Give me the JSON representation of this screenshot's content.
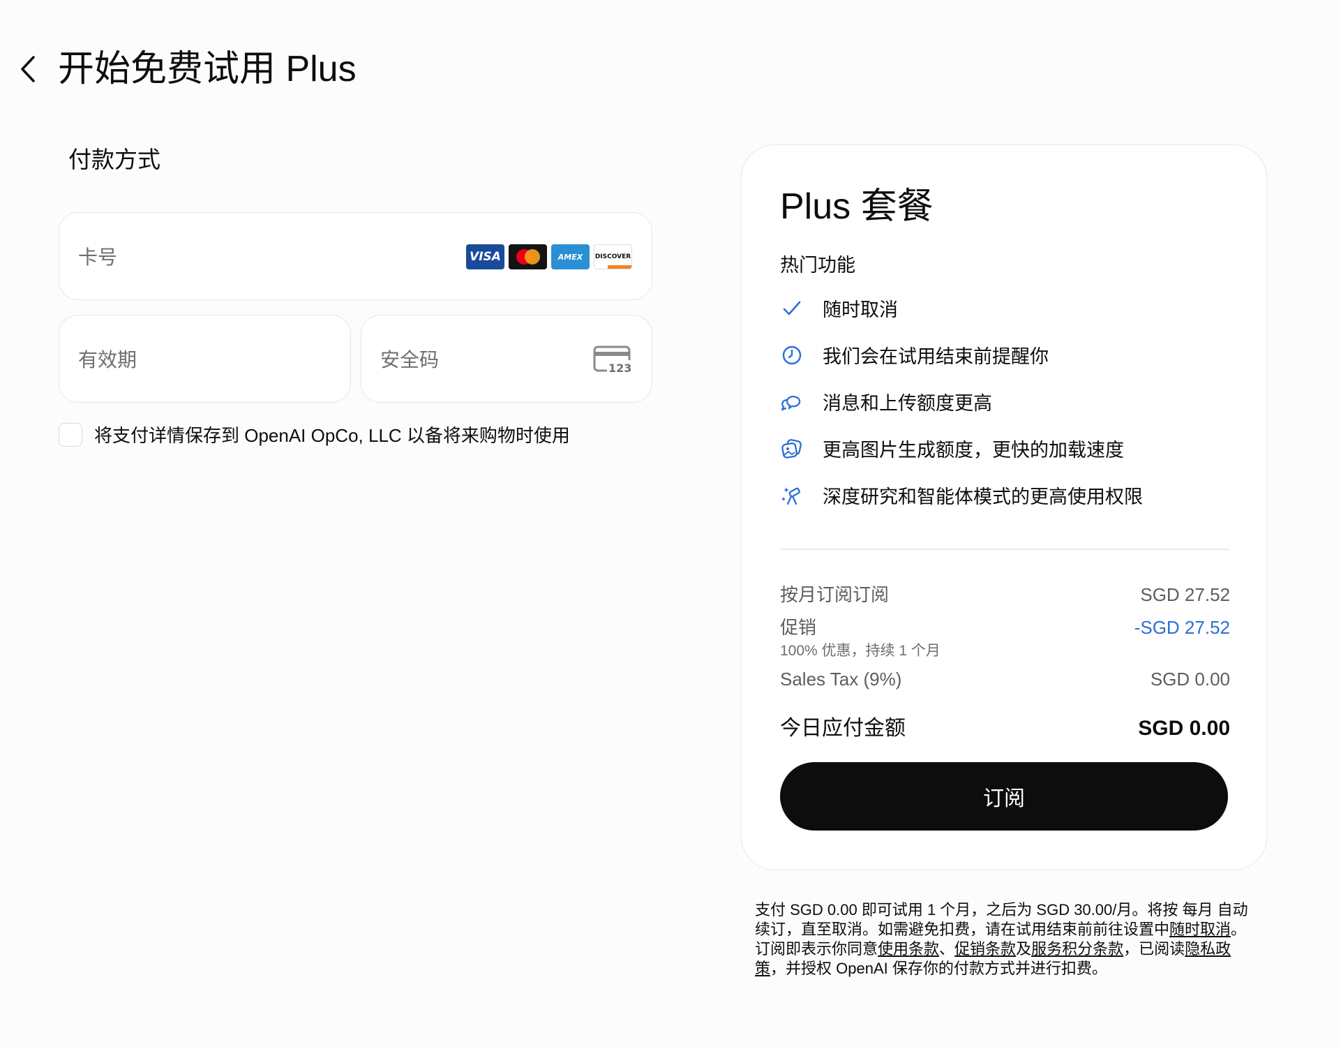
{
  "header": {
    "title": "开始免费试用 Plus"
  },
  "payment": {
    "section_title": "付款方式",
    "card_number_placeholder": "卡号",
    "card_brands": [
      "VISA",
      "Mastercard",
      "AMEX",
      "DISCOVER"
    ],
    "expiry_placeholder": "有效期",
    "cvc_placeholder": "安全码",
    "cvc_icon_text": "123",
    "save_details_label": "将支付详情保存到 OpenAI OpCo, LLC 以备将来购物时使用"
  },
  "plan": {
    "title": "Plus 套餐",
    "features_title": "热门功能",
    "features": [
      {
        "icon": "check-icon",
        "label": "随时取消"
      },
      {
        "icon": "clock-icon",
        "label": "我们会在试用结束前提醒你"
      },
      {
        "icon": "chat-bubbles-icon",
        "label": "消息和上传额度更高"
      },
      {
        "icon": "image-gallery-icon",
        "label": "更高图片生成额度，更快的加载速度"
      },
      {
        "icon": "telescope-icon",
        "label": "深度研究和智能体模式的更高使用权限"
      }
    ],
    "pricing": {
      "monthly_label": "按月订阅订阅",
      "monthly_value": "SGD 27.52",
      "promo_label": "促销",
      "promo_value": "-SGD 27.52",
      "promo_detail": "100% 优惠，持续 1 个月",
      "tax_label": "Sales Tax (9%)",
      "tax_value": "SGD 0.00",
      "total_label": "今日应付金额",
      "total_value": "SGD 0.00"
    },
    "subscribe_label": "订阅"
  },
  "legal": {
    "part1": "支付 SGD 0.00 即可试用 1 个月，之后为 SGD 30.00/月。将按 每月 自动续订，直至取消。如需避免扣费，请在试用结束前前往设置中",
    "cancel_link": "随时取消",
    "part2": "。订阅即表示你同意",
    "terms_link": "使用条款",
    "sep1": "、",
    "promo_terms_link": "促销条款",
    "sep2": "及",
    "points_terms_link": "服务积分条款",
    "part3": "，已阅读",
    "privacy_link": "隐私政策",
    "part4": "，并授权 OpenAI 保存你的付款方式并进行扣费。"
  },
  "colors": {
    "accent_blue": "#2b6ed3",
    "button_bg": "#0d0d0d",
    "page_bg": "#fcfcfc"
  }
}
